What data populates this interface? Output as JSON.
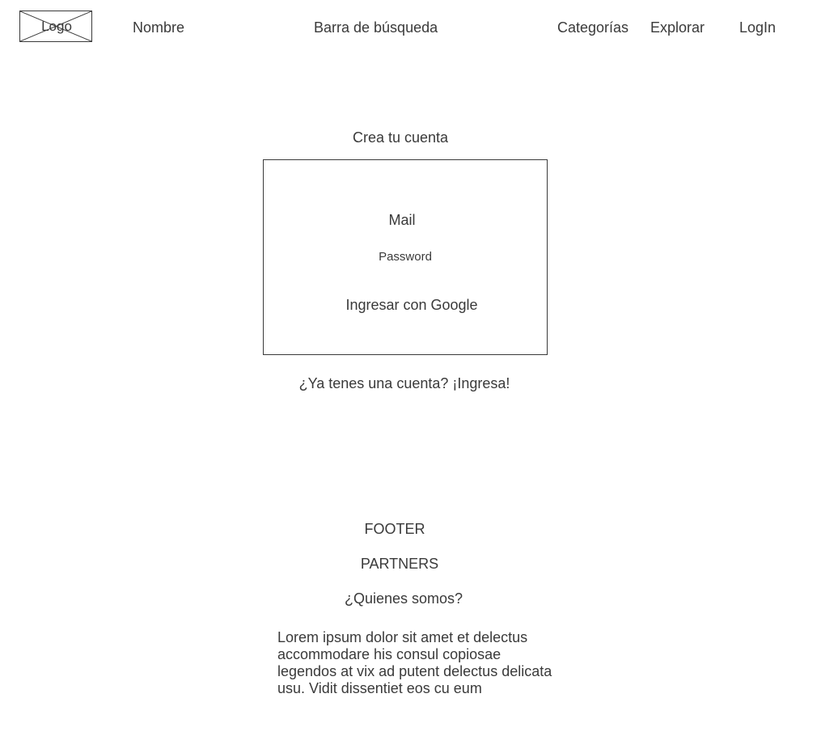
{
  "header": {
    "logo_label": "Logo",
    "name_label": "Nombre",
    "search_label": "Barra de búsqueda",
    "categories_label": "Categorías",
    "explore_label": "Explorar",
    "login_label": "LogIn"
  },
  "signup": {
    "title": "Crea tu cuenta",
    "mail_label": "Mail",
    "password_label": "Password",
    "google_label": "Ingresar con Google",
    "have_account_label": "¿Ya tenes una cuenta? ¡Ingresa!"
  },
  "footer": {
    "title": "FOOTER",
    "partners_label": "PARTNERS",
    "about_label": "¿Quienes somos?",
    "about_text": "Lorem ipsum dolor sit amet et delectus accommodare his consul copiosae legendos at vix ad putent delectus delicata usu. Vidit dissentiet eos cu eum"
  }
}
